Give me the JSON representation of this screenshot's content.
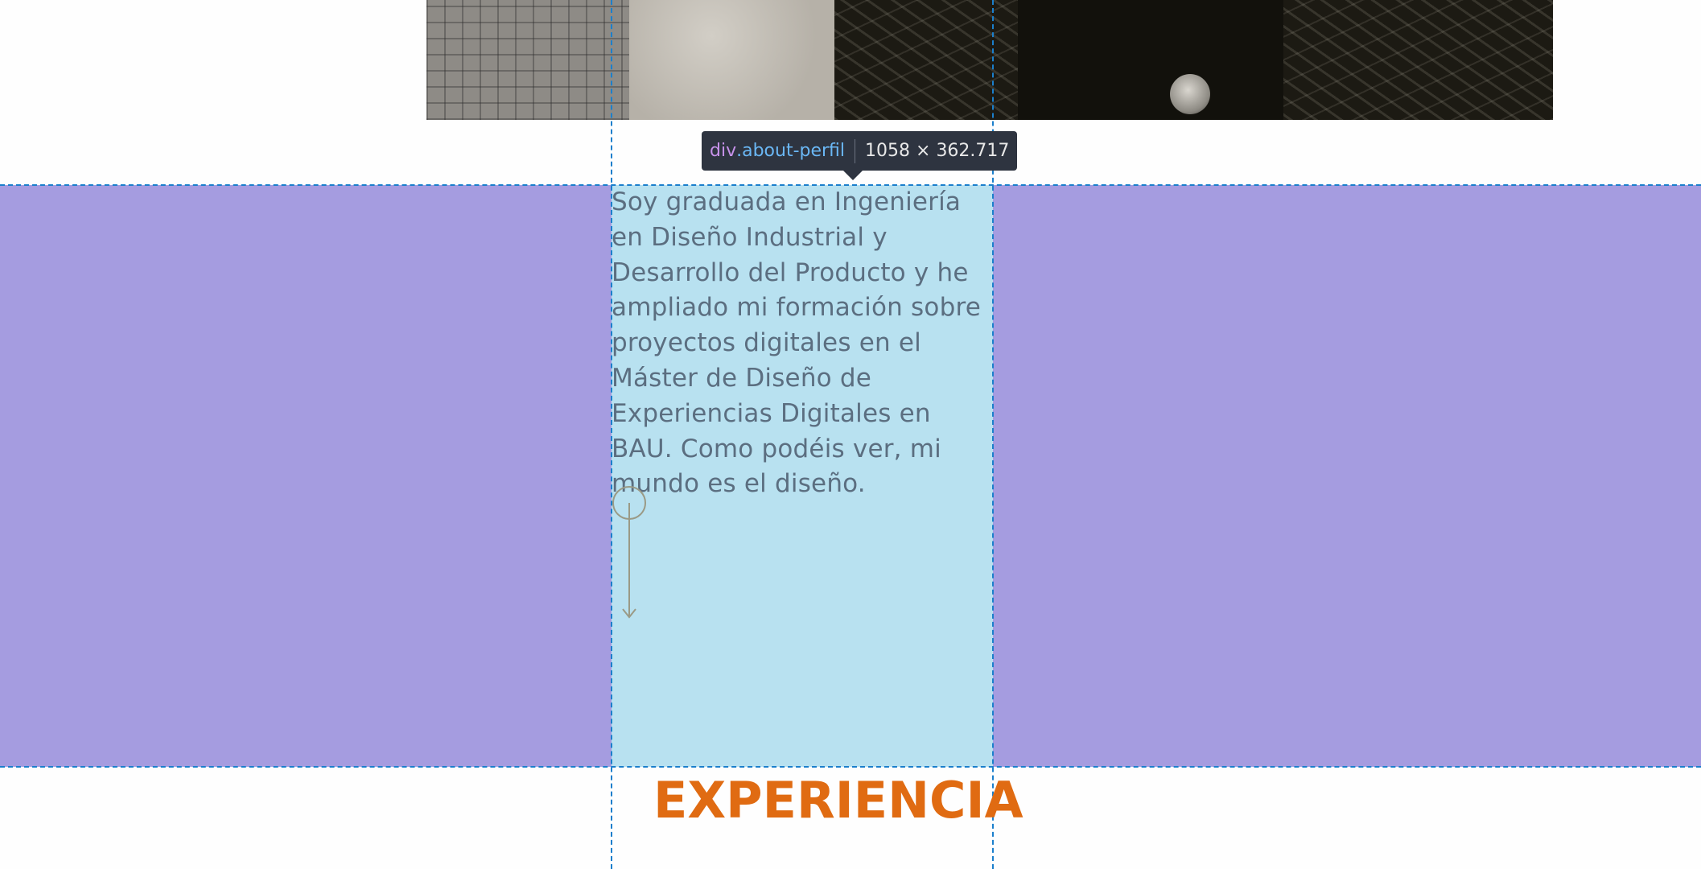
{
  "inspector_tooltip": {
    "tag": "div",
    "class_name": ".about-perfil",
    "dimensions": "1058 × 362.717"
  },
  "about": {
    "text": "Soy graduada en Ingeniería en Diseño Industrial y Desarrollo del Producto y he ampliado mi formación sobre proyectos digitales en el Máster de Diseño de Experiencias Digitales en BAU. Como podéis ver, mi mundo es el diseño."
  },
  "section_heading": "EXPERIENCIA",
  "colors": {
    "section_background": "#a59ce0",
    "highlight_overlay": "#b8e1f0",
    "heading_color": "#e06b12",
    "guide_line": "#1b7fcc",
    "tooltip_background": "#2e3440"
  },
  "icons": {
    "scroll_down": "scroll-down-arrow-icon"
  }
}
